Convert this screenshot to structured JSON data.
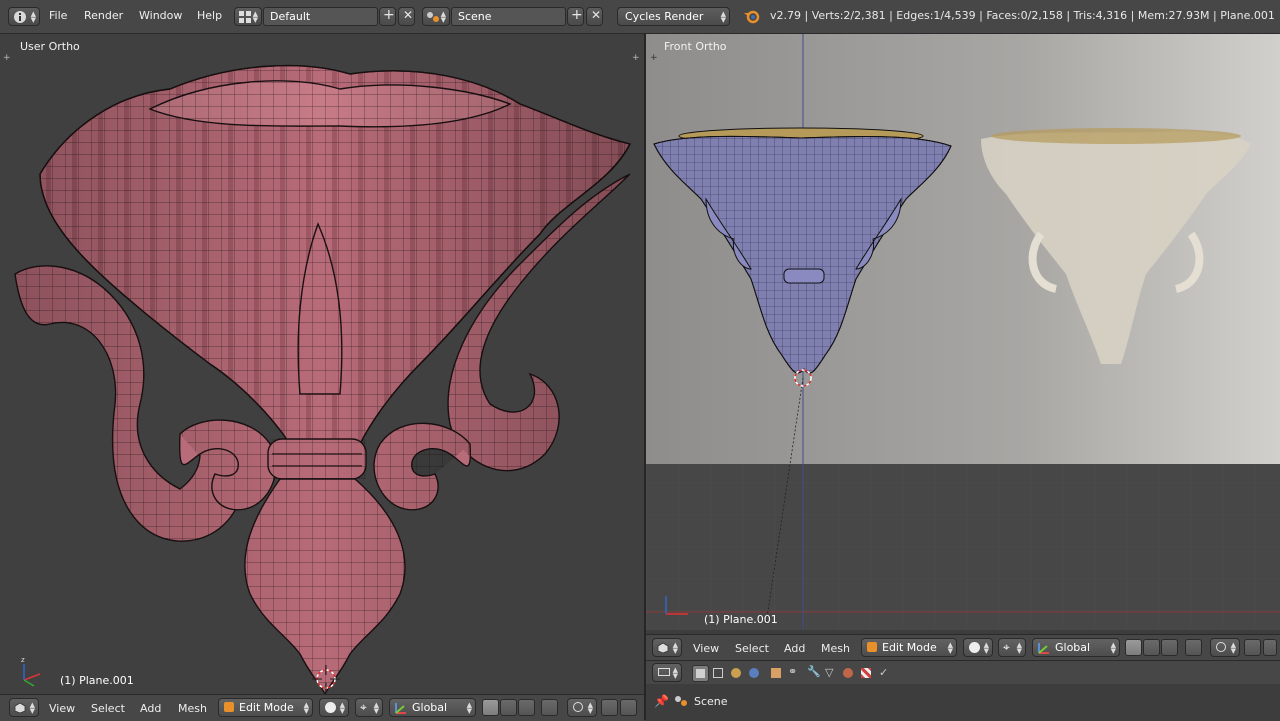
{
  "header": {
    "menus": [
      "File",
      "Render",
      "Window",
      "Help"
    ],
    "layout": "Default",
    "scene": "Scene",
    "engine": "Cycles Render",
    "stats": "v2.79 | Verts:2/2,381 | Edges:1/4,539 | Faces:0/2,158 | Tris:4,316 | Mem:27.93M | Plane.001"
  },
  "left_view": {
    "label": "User Ortho",
    "object": "(1) Plane.001",
    "mesh_color": "#b86b78"
  },
  "right_view": {
    "label": "Front Ortho",
    "object": "(1) Plane.001",
    "mesh_color": "#7f7fb0"
  },
  "view_header": {
    "menus": [
      "View",
      "Select",
      "Add",
      "Mesh"
    ],
    "mode": "Edit Mode",
    "orientation": "Global"
  },
  "props_header": {
    "tabs": [
      "render-icon",
      "layers-icon",
      "scene-icon",
      "world-icon",
      "object-icon",
      "constraint-icon",
      "modifier-icon",
      "data-icon",
      "material-icon",
      "texture-icon",
      "physics-icon"
    ]
  },
  "outliner": {
    "item": "Scene"
  },
  "colors": {
    "header_bg": "#474747",
    "viewport_bg": "#404040",
    "accent_orange": "#e8902a"
  }
}
